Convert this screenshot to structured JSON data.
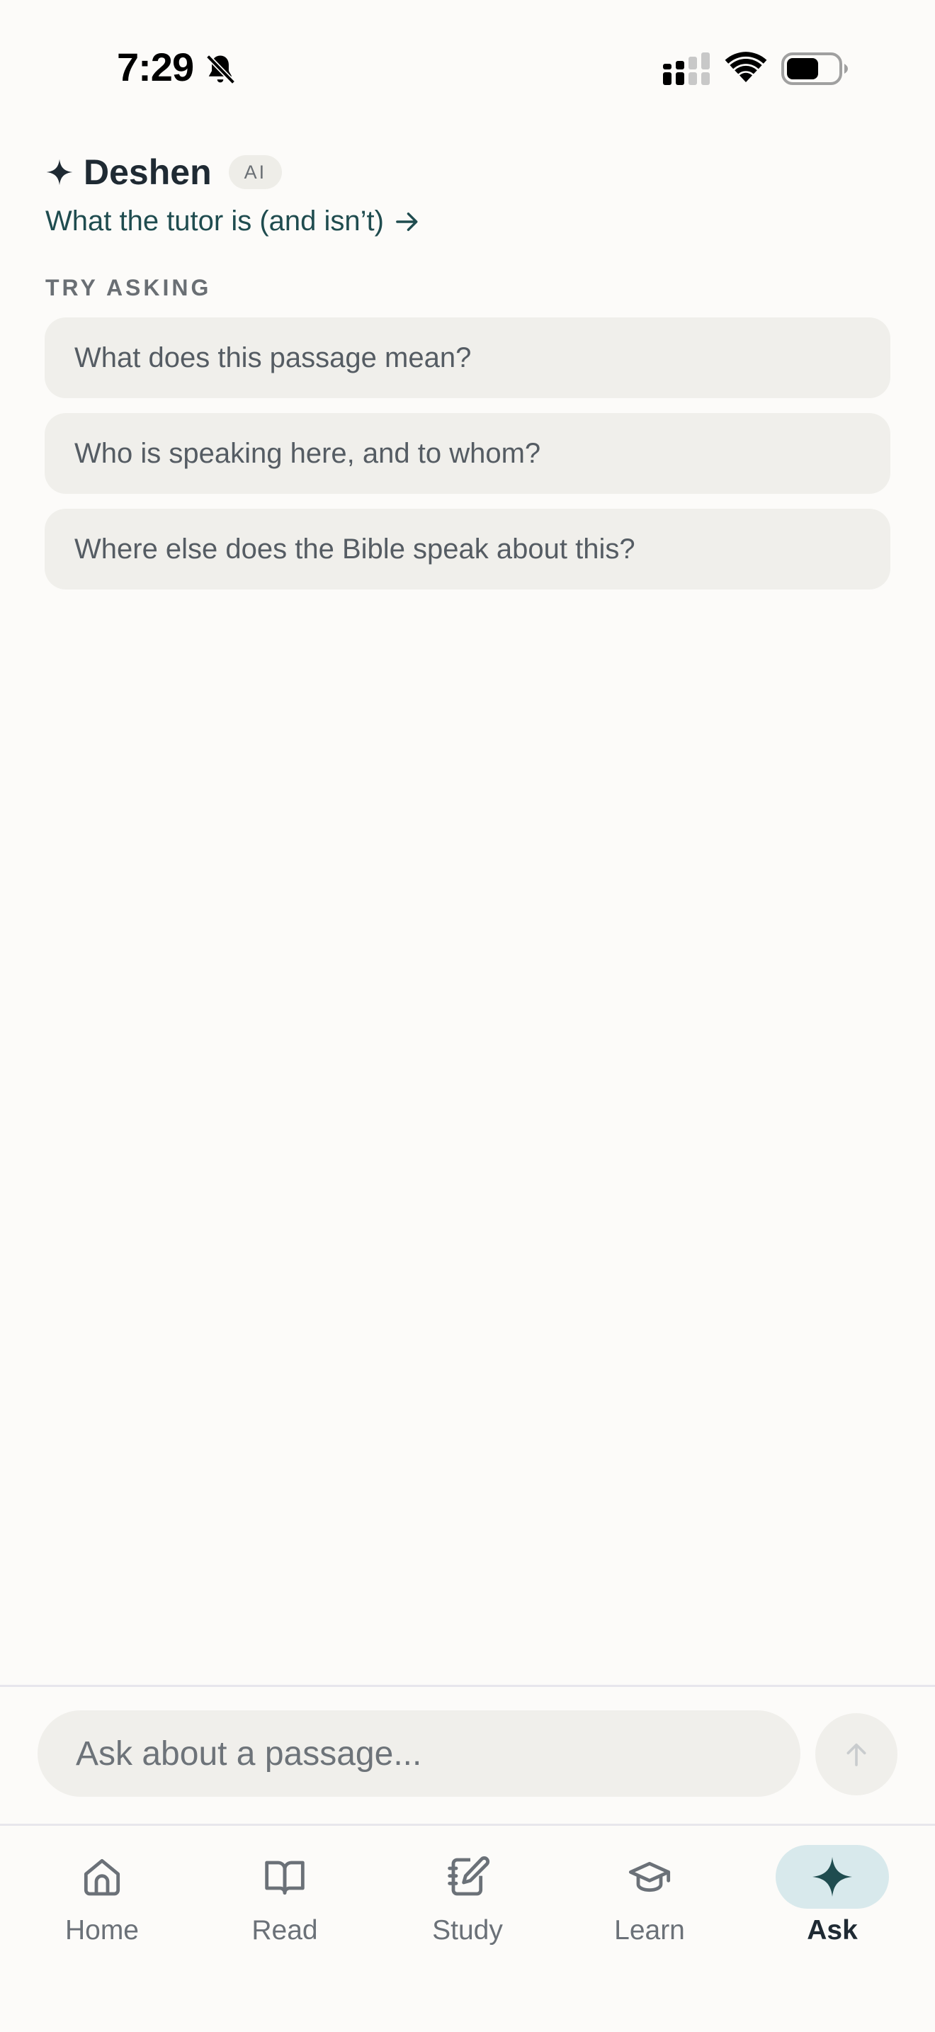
{
  "status_bar": {
    "time": "7:29"
  },
  "header": {
    "title": "Deshen",
    "badge": "AI",
    "about_link": "What the tutor is (and isn’t)"
  },
  "suggestions": {
    "label": "TRY ASKING",
    "items": [
      "What does this passage mean?",
      "Who is speaking here, and to whom?",
      "Where else does the Bible speak about this?"
    ]
  },
  "composer": {
    "placeholder": "Ask about a passage..."
  },
  "tabs": [
    {
      "label": "Home",
      "icon": "home-icon"
    },
    {
      "label": "Read",
      "icon": "book-open-icon"
    },
    {
      "label": "Study",
      "icon": "notebook-pen-icon"
    },
    {
      "label": "Learn",
      "icon": "graduation-cap-icon"
    },
    {
      "label": "Ask",
      "icon": "sparkle-icon",
      "active": true
    }
  ],
  "colors": {
    "background": "#fcfbf9",
    "accent": "#1f4c4f",
    "active_tab_pill": "#d8e9ec",
    "chip_background": "#f0efeb"
  }
}
